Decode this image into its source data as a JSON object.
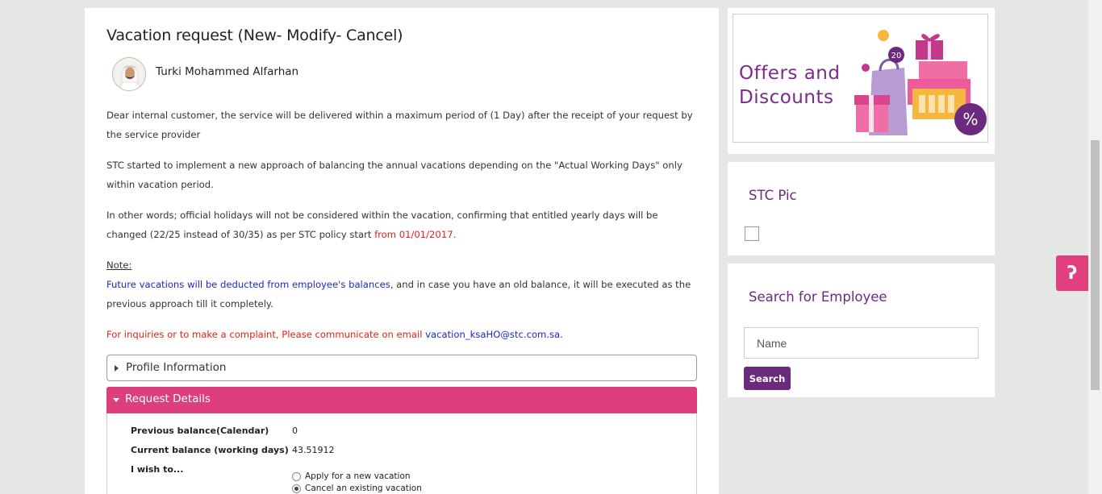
{
  "page": {
    "title": "Vacation request (New- Modify- Cancel)",
    "user_name": "Turki Mohammed Alfarhan"
  },
  "intro": {
    "p1": "Dear internal customer, the service will be delivered within a maximum period of (1 Day) after the receipt of your request by the service provider",
    "p2": "STC started to implement a new approach of balancing the annual vacations depending on the \"Actual Working Days\" only within vacation period.",
    "p3_a": "In other words; official holidays will not be considered within the vacation, confirming that entitled yearly days will be changed (22/25 instead of 30/35) as per STC policy start ",
    "p3_b": "from 01/01/2017.",
    "note_label": "Note:",
    "note_blue": "Future vacations will be deducted from employee's balances",
    "note_rest": ", and in case you have an old balance, it will be executed as the previous approach till it completely.",
    "inquiry": "For inquiries or to make a complaint, Please communicate on email ",
    "email": "vacation_ksaHO@stc.com.sa",
    "email_end": "."
  },
  "sections": {
    "profile": "Profile Information",
    "request": "Request Details"
  },
  "request_details": {
    "previous_balance_label": "Previous balance(Calendar)",
    "previous_balance_value": "0",
    "current_balance_label": "Current balance (working days)",
    "current_balance_value": "43.51912",
    "wish_label": "I wish to...",
    "options": [
      {
        "label": "Apply for a new vacation",
        "selected": false
      },
      {
        "label": "Cancel an existing vacation",
        "selected": true
      }
    ]
  },
  "sidebar": {
    "ad": {
      "line1": "Offers and",
      "line2": "Discounts"
    },
    "pic_title": "STC Pic",
    "search_title": "Search for Employee",
    "name_placeholder": "Name",
    "search_button": "Search"
  },
  "help": {
    "icon": "question-mark-icon"
  },
  "colors": {
    "brand_purple": "#6b2a7e",
    "brand_pink": "#dc3f7b",
    "link_blue": "#1d28c9",
    "alert_red": "#e2231a"
  }
}
